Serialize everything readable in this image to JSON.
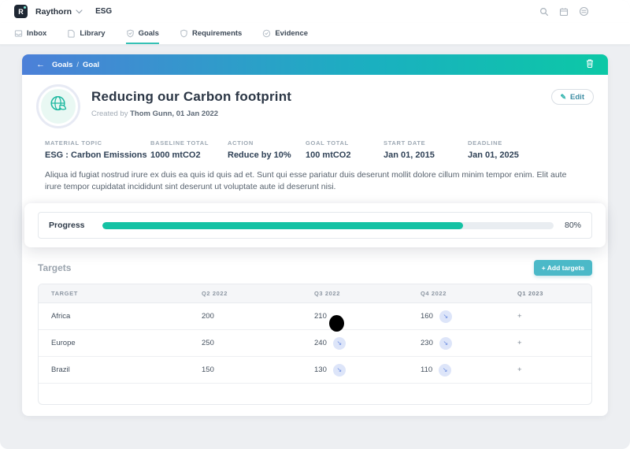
{
  "topbar": {
    "logo_letter": "R",
    "company_name": "Raythorn",
    "workspace": "ESG"
  },
  "nav": {
    "active_tab": "Goals",
    "tabs": [
      {
        "label": "Inbox"
      },
      {
        "label": "Library"
      },
      {
        "label": "Goals"
      },
      {
        "label": "Requirements"
      },
      {
        "label": "Evidence"
      }
    ]
  },
  "breadcrumb": {
    "back_icon": "←",
    "parent": "Goals",
    "separator": "/",
    "current": "Goal"
  },
  "goal": {
    "title": "Reducing our Carbon footprint",
    "created_prefix": "Created by",
    "created_detail": "Thom Gunn, 01 Jan 2022",
    "edit_button": {
      "icon": "✎",
      "label": "Edit"
    },
    "meta": [
      {
        "label": "MATERIAL TOPIC",
        "value": "ESG : Carbon Emissions"
      },
      {
        "label": "BASELINE TOTAL",
        "value": "1000 mtCO2"
      },
      {
        "label": "ACTION",
        "value": "Reduce by 10%"
      },
      {
        "label": "GOAL TOTAL",
        "value": "100 mtCO2"
      },
      {
        "label": "START DATE",
        "value": "Jan 01, 2015"
      },
      {
        "label": "DEADLINE",
        "value": "Jan 01, 2025"
      }
    ],
    "description": "Aliqua id fugiat nostrud irure ex duis ea quis id quis ad et. Sunt qui esse pariatur duis deserunt mollit dolore cillum minim tempor enim. Elit aute irure tempor cupidatat incididunt sint deserunt ut voluptate aute id deserunt nisi."
  },
  "progress": {
    "label": "Progress",
    "percent": 80,
    "percent_label": "80%"
  },
  "targets": {
    "heading": "Targets",
    "add_button_label": "+ Add targets",
    "columns": [
      "TARGET",
      "Q2 2022",
      "Q3 2022",
      "Q4 2022",
      "Q1 2023"
    ],
    "badge_icon": "↘",
    "plus_label": "+",
    "rows": [
      {
        "name": "Africa",
        "q2": "200",
        "q3": "210",
        "q4": "160"
      },
      {
        "name": "Europe",
        "q2": "250",
        "q3": "240",
        "q4": "230"
      },
      {
        "name": "Brazil",
        "q2": "150",
        "q3": "130",
        "q4": "110"
      }
    ]
  },
  "colors": {
    "accent_teal": "#15c2a4",
    "accent_cyan": "#4bb9c8",
    "gradient_start": "#4c80d8",
    "gradient_end": "#0cc8a6",
    "badge_bg": "#dde5f9",
    "badge_arrow": "#6b8ce0"
  }
}
